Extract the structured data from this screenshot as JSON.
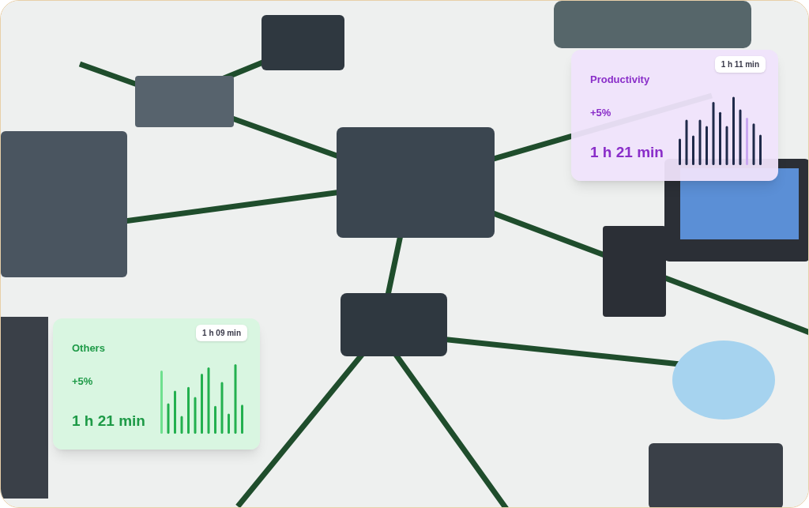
{
  "cards": [
    {
      "kind": "purple",
      "title": "Productivity",
      "change": "+5%",
      "total": "1 h 21 min",
      "tooltip": "1 h 11 min"
    },
    {
      "kind": "green",
      "title": "Others",
      "change": "+5%",
      "total": "1 h 21 min",
      "tooltip": "1 h 09 min"
    }
  ]
}
